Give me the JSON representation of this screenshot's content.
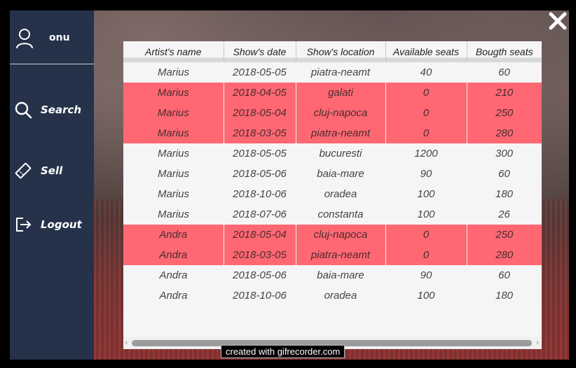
{
  "sidebar": {
    "username": "onu",
    "nav": [
      {
        "label": "Search",
        "icon": "search-icon"
      },
      {
        "label": "Sell",
        "icon": "ticket-icon"
      },
      {
        "label": "Logout",
        "icon": "logout-icon"
      }
    ]
  },
  "colors": {
    "sidebar": "#25324a",
    "highlight_row": "#ff6873",
    "panel": "#f5f5f5"
  },
  "table": {
    "columns": [
      "Artist's name",
      "Show's date",
      "Show's location",
      "Available seats",
      "Bougth seats"
    ],
    "rows": [
      {
        "artist": "Marius",
        "date": "2018-05-05",
        "location": "piatra-neamt",
        "available": "40",
        "bought": "60",
        "highlighted": false
      },
      {
        "artist": "Marius",
        "date": "2018-04-05",
        "location": "galati",
        "available": "0",
        "bought": "210",
        "highlighted": true
      },
      {
        "artist": "Marius",
        "date": "2018-05-04",
        "location": "cluj-napoca",
        "available": "0",
        "bought": "250",
        "highlighted": true
      },
      {
        "artist": "Marius",
        "date": "2018-03-05",
        "location": "piatra-neamt",
        "available": "0",
        "bought": "280",
        "highlighted": true
      },
      {
        "artist": "Marius",
        "date": "2018-05-05",
        "location": "bucuresti",
        "available": "1200",
        "bought": "300",
        "highlighted": false
      },
      {
        "artist": "Marius",
        "date": "2018-05-06",
        "location": "baia-mare",
        "available": "90",
        "bought": "60",
        "highlighted": false
      },
      {
        "artist": "Marius",
        "date": "2018-10-06",
        "location": "oradea",
        "available": "100",
        "bought": "180",
        "highlighted": false
      },
      {
        "artist": "Marius",
        "date": "2018-07-06",
        "location": "constanta",
        "available": "100",
        "bought": "26",
        "highlighted": false
      },
      {
        "artist": "Andra",
        "date": "2018-05-04",
        "location": "cluj-napoca",
        "available": "0",
        "bought": "250",
        "highlighted": true
      },
      {
        "artist": "Andra",
        "date": "2018-03-05",
        "location": "piatra-neamt",
        "available": "0",
        "bought": "280",
        "highlighted": true
      },
      {
        "artist": "Andra",
        "date": "2018-05-06",
        "location": "baia-mare",
        "available": "90",
        "bought": "60",
        "highlighted": false
      },
      {
        "artist": "Andra",
        "date": "2018-10-06",
        "location": "oradea",
        "available": "100",
        "bought": "180",
        "highlighted": false
      }
    ]
  },
  "scrollbar": {
    "left_arrow": "‹",
    "right_arrow": "›"
  },
  "watermark": "created with gifrecorder.com"
}
